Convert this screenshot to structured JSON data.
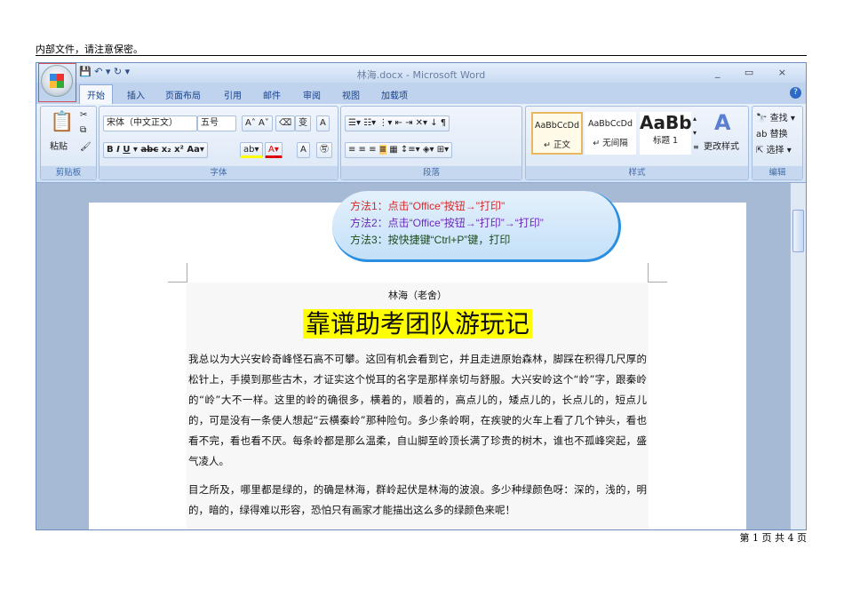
{
  "doc_header": "内部文件，请注意保密。",
  "doc_footer": "第 1 页 共 4 页",
  "window": {
    "title": "林海.docx - Microsoft Word",
    "controls": "_ ▭ ×"
  },
  "tabs": [
    "开始",
    "插入",
    "页面布局",
    "引用",
    "邮件",
    "审阅",
    "视图",
    "加载项"
  ],
  "ribbon": {
    "clipboard": {
      "label": "剪贴板",
      "paste": "粘贴"
    },
    "font": {
      "label": "字体",
      "font_name": "宋体（中文正文）",
      "font_size": "五号"
    },
    "paragraph": {
      "label": "段落"
    },
    "styles": {
      "label": "样式",
      "items": [
        {
          "preview": "AaBbCcDd",
          "name": "↵ 正文"
        },
        {
          "preview": "AaBbCcDd",
          "name": "↵ 无间隔"
        },
        {
          "preview": "AaBb",
          "name": "标题 1"
        }
      ],
      "change": "更改样式"
    },
    "editing": {
      "label": "编辑",
      "find": "查找",
      "replace": "替换",
      "select": "选择"
    }
  },
  "callout": {
    "line1": "方法1：点击“Office”按钮→\"打印\"",
    "line2": "方法2：点击“Office”按钮→“打印”→“打印”",
    "line3": "方法3：按快捷键“Ctrl+P”键，打印",
    "colors": [
      "#d42a2a",
      "#6a2bb8",
      "#1d4d1d"
    ]
  },
  "document": {
    "author": "林海（老舍）",
    "title": "靠谱助考团队游玩记",
    "para1": "我总以为大兴安岭奇峰怪石高不可攀。这回有机会看到它，并且走进原始森林，脚踩在积得几尺厚的松针上，手摸到那些古木，才证实这个悦耳的名字是那样亲切与舒服。大兴安岭这个“岭”字，跟秦岭的“岭”大不一样。这里的岭的确很多，横着的，顺着的，高点儿的，矮点儿的，长点儿的，短点儿的，可是没有一条使人想起“云横秦岭”那种险句。多少条岭啊，在疾驶的火车上看了几个钟头，看也看不完，看也看不厌。每条岭都是那么温柔，自山脚至岭顶长满了珍贵的树木，谁也不孤峰突起，盛气凌人。",
    "para2": "目之所及，哪里都是绿的，的确是林海，群岭起伏是林海的波浪。多少种绿颜色呀：深的，浅的，明的，暗的，绿得难以形容，恐怕只有画家才能描出这么多的绿颜色来呢！"
  }
}
